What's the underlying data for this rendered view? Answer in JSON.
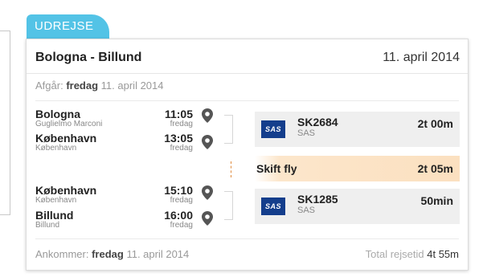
{
  "tab_label": "UDREJSE",
  "header": {
    "route": "Bologna - Billund",
    "date": "11. april 2014"
  },
  "departure": {
    "label": "Afgår:",
    "weekday": "fredag",
    "date": "11. april 2014"
  },
  "segments": [
    {
      "from": {
        "city": "Bologna",
        "airport": "Guglielmo Marconi",
        "time": "11:05",
        "day": "fredag"
      },
      "to": {
        "city": "København",
        "airport": "København",
        "time": "13:05",
        "day": "fredag"
      },
      "flight": {
        "logo_text": "SAS",
        "number": "SK2684",
        "airline": "SAS",
        "duration": "2t 00m"
      }
    },
    {
      "from": {
        "city": "København",
        "airport": "København",
        "time": "15:10",
        "day": "fredag"
      },
      "to": {
        "city": "Billund",
        "airport": "Billund",
        "time": "16:00",
        "day": "fredag"
      },
      "flight": {
        "logo_text": "SAS",
        "number": "SK1285",
        "airline": "SAS",
        "duration": "50min"
      }
    }
  ],
  "transfer": {
    "label": "Skift fly",
    "duration": "2t 05m"
  },
  "arrival": {
    "label": "Ankommer:",
    "weekday": "fredag",
    "date": "11. april 2014"
  },
  "total": {
    "label": "Total rejsetid",
    "value": "4t 55m"
  },
  "colors": {
    "tab": "#53c3e6",
    "transfer_bg": "#fbe0c0",
    "sas_blue": "#143e8c"
  }
}
